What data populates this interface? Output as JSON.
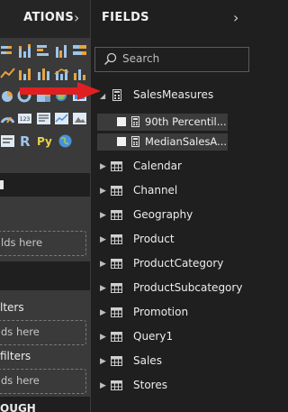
{
  "left_pane": {
    "title": "ATIONS",
    "collapse_icon": "chevron-right-icon",
    "viz_icons": [
      "stacked-bar-icon",
      "stacked-column-icon",
      "clustered-bar-icon",
      "clustered-column-icon",
      "100-bar-icon",
      "line-icon",
      "area-icon",
      "stacked-area-icon",
      "line-column-icon",
      "ribbon-icon",
      "waterfall-icon",
      "scatter-icon",
      "pie-icon",
      "donut-icon",
      "treemap-icon",
      "map-icon",
      "filled-map-icon",
      "funnel-icon",
      "gauge-icon",
      "card-icon",
      "multirow-card-icon",
      "kpi-icon",
      "slicer-icon",
      "table-icon",
      "matrix-icon",
      "r-visual-icon",
      "python-visual-icon",
      "globe-icon"
    ],
    "r_label": "R",
    "py_label": "Py",
    "values_drop": "lds here",
    "filters_label": "lters",
    "filters_drop": "ds here",
    "all_filters_label": "filters",
    "all_filters_drop": "ds here",
    "bottom_label": "OUGH"
  },
  "fields_pane": {
    "title": "FIELDS",
    "collapse_icon": "chevron-right-icon",
    "search_placeholder": "Search",
    "expanded_table": "SalesMeasures",
    "measures": [
      "90th Percentil...",
      "MedianSalesA..."
    ],
    "tables": [
      "Calendar",
      "Channel",
      "Geography",
      "Product",
      "ProductCategory",
      "ProductSubcategory",
      "Promotion",
      "Query1",
      "Sales",
      "Stores"
    ]
  },
  "annotation": {
    "arrow_color": "#e02020"
  },
  "colors": {
    "pane_bg": "#1f1f1f",
    "left_bg": "#3a3a3a",
    "measure_row_bg": "#3b3b3b",
    "accent_red": "#e02020"
  }
}
